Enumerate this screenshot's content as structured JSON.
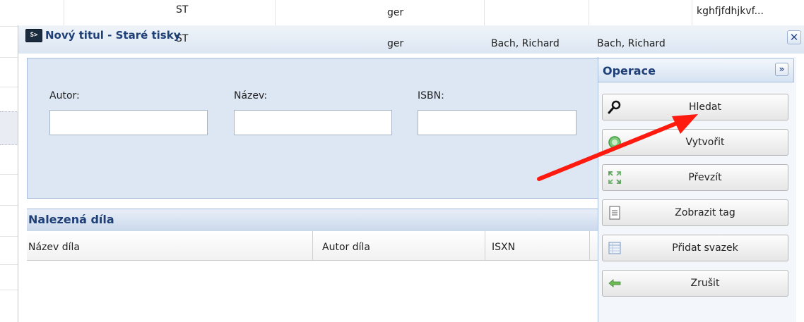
{
  "background_grid": {
    "row1": {
      "col_type": "ST",
      "col_lang": "ger",
      "col_last": "kghfjfdhjkvf..."
    },
    "row2": {
      "col_type": "ST",
      "col_lang": "ger",
      "col_author1": "Bach, Richard",
      "col_author2": "Bach, Richard"
    }
  },
  "dialog": {
    "title_icon": "S>",
    "title": "Nový titul - Staré tisky",
    "close_label": "✕"
  },
  "search_form": {
    "author_label": "Autor:",
    "author_value": "",
    "title_label": "Název:",
    "title_value": "",
    "isbn_label": "ISBN:",
    "isbn_value": ""
  },
  "results": {
    "title": "Nalezená díla",
    "columns": [
      "Název díla",
      "Autor díla",
      "ISXN"
    ],
    "rows": []
  },
  "operations": {
    "title": "Operace",
    "expand_label": "»",
    "buttons": [
      {
        "label": "Hledat",
        "icon": "magnifier-icon"
      },
      {
        "label": "Vytvořit",
        "icon": "create-green-circle-icon"
      },
      {
        "label": "Převzít",
        "icon": "take-over-arrows-icon"
      },
      {
        "label": "Zobrazit tag",
        "icon": "document-tag-icon"
      },
      {
        "label": "Přidat svazek",
        "icon": "add-volume-table-icon"
      },
      {
        "label": "Zrušit",
        "icon": "cancel-arrow-left-icon"
      }
    ]
  },
  "annotation": {
    "arrow_color": "#ff1a0f"
  }
}
